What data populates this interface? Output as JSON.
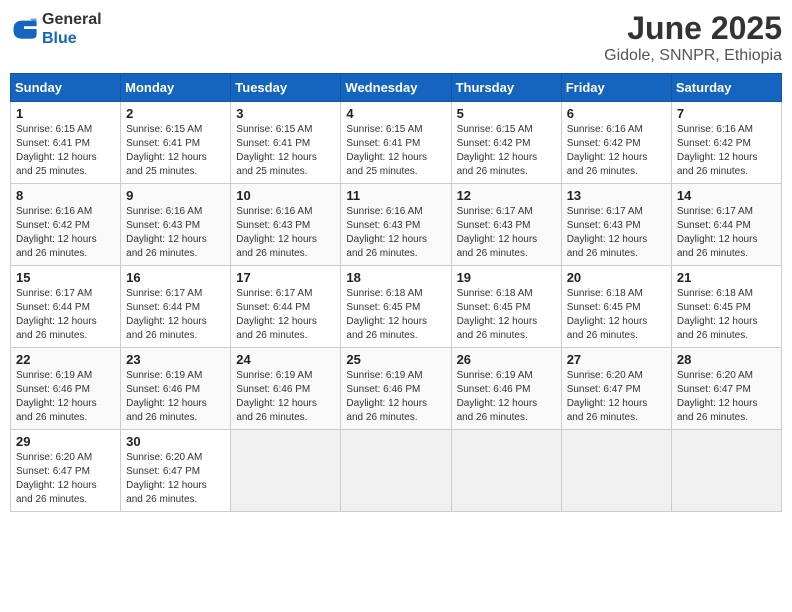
{
  "header": {
    "logo_general": "General",
    "logo_blue": "Blue",
    "title": "June 2025",
    "subtitle": "Gidole, SNNPR, Ethiopia"
  },
  "weekdays": [
    "Sunday",
    "Monday",
    "Tuesday",
    "Wednesday",
    "Thursday",
    "Friday",
    "Saturday"
  ],
  "weeks": [
    [
      {
        "day": "1",
        "sunrise": "6:15 AM",
        "sunset": "6:41 PM",
        "daylight": "12 hours and 25 minutes."
      },
      {
        "day": "2",
        "sunrise": "6:15 AM",
        "sunset": "6:41 PM",
        "daylight": "12 hours and 25 minutes."
      },
      {
        "day": "3",
        "sunrise": "6:15 AM",
        "sunset": "6:41 PM",
        "daylight": "12 hours and 25 minutes."
      },
      {
        "day": "4",
        "sunrise": "6:15 AM",
        "sunset": "6:41 PM",
        "daylight": "12 hours and 25 minutes."
      },
      {
        "day": "5",
        "sunrise": "6:15 AM",
        "sunset": "6:42 PM",
        "daylight": "12 hours and 26 minutes."
      },
      {
        "day": "6",
        "sunrise": "6:16 AM",
        "sunset": "6:42 PM",
        "daylight": "12 hours and 26 minutes."
      },
      {
        "day": "7",
        "sunrise": "6:16 AM",
        "sunset": "6:42 PM",
        "daylight": "12 hours and 26 minutes."
      }
    ],
    [
      {
        "day": "8",
        "sunrise": "6:16 AM",
        "sunset": "6:42 PM",
        "daylight": "12 hours and 26 minutes."
      },
      {
        "day": "9",
        "sunrise": "6:16 AM",
        "sunset": "6:43 PM",
        "daylight": "12 hours and 26 minutes."
      },
      {
        "day": "10",
        "sunrise": "6:16 AM",
        "sunset": "6:43 PM",
        "daylight": "12 hours and 26 minutes."
      },
      {
        "day": "11",
        "sunrise": "6:16 AM",
        "sunset": "6:43 PM",
        "daylight": "12 hours and 26 minutes."
      },
      {
        "day": "12",
        "sunrise": "6:17 AM",
        "sunset": "6:43 PM",
        "daylight": "12 hours and 26 minutes."
      },
      {
        "day": "13",
        "sunrise": "6:17 AM",
        "sunset": "6:43 PM",
        "daylight": "12 hours and 26 minutes."
      },
      {
        "day": "14",
        "sunrise": "6:17 AM",
        "sunset": "6:44 PM",
        "daylight": "12 hours and 26 minutes."
      }
    ],
    [
      {
        "day": "15",
        "sunrise": "6:17 AM",
        "sunset": "6:44 PM",
        "daylight": "12 hours and 26 minutes."
      },
      {
        "day": "16",
        "sunrise": "6:17 AM",
        "sunset": "6:44 PM",
        "daylight": "12 hours and 26 minutes."
      },
      {
        "day": "17",
        "sunrise": "6:17 AM",
        "sunset": "6:44 PM",
        "daylight": "12 hours and 26 minutes."
      },
      {
        "day": "18",
        "sunrise": "6:18 AM",
        "sunset": "6:45 PM",
        "daylight": "12 hours and 26 minutes."
      },
      {
        "day": "19",
        "sunrise": "6:18 AM",
        "sunset": "6:45 PM",
        "daylight": "12 hours and 26 minutes."
      },
      {
        "day": "20",
        "sunrise": "6:18 AM",
        "sunset": "6:45 PM",
        "daylight": "12 hours and 26 minutes."
      },
      {
        "day": "21",
        "sunrise": "6:18 AM",
        "sunset": "6:45 PM",
        "daylight": "12 hours and 26 minutes."
      }
    ],
    [
      {
        "day": "22",
        "sunrise": "6:19 AM",
        "sunset": "6:46 PM",
        "daylight": "12 hours and 26 minutes."
      },
      {
        "day": "23",
        "sunrise": "6:19 AM",
        "sunset": "6:46 PM",
        "daylight": "12 hours and 26 minutes."
      },
      {
        "day": "24",
        "sunrise": "6:19 AM",
        "sunset": "6:46 PM",
        "daylight": "12 hours and 26 minutes."
      },
      {
        "day": "25",
        "sunrise": "6:19 AM",
        "sunset": "6:46 PM",
        "daylight": "12 hours and 26 minutes."
      },
      {
        "day": "26",
        "sunrise": "6:19 AM",
        "sunset": "6:46 PM",
        "daylight": "12 hours and 26 minutes."
      },
      {
        "day": "27",
        "sunrise": "6:20 AM",
        "sunset": "6:47 PM",
        "daylight": "12 hours and 26 minutes."
      },
      {
        "day": "28",
        "sunrise": "6:20 AM",
        "sunset": "6:47 PM",
        "daylight": "12 hours and 26 minutes."
      }
    ],
    [
      {
        "day": "29",
        "sunrise": "6:20 AM",
        "sunset": "6:47 PM",
        "daylight": "12 hours and 26 minutes."
      },
      {
        "day": "30",
        "sunrise": "6:20 AM",
        "sunset": "6:47 PM",
        "daylight": "12 hours and 26 minutes."
      },
      null,
      null,
      null,
      null,
      null
    ]
  ]
}
